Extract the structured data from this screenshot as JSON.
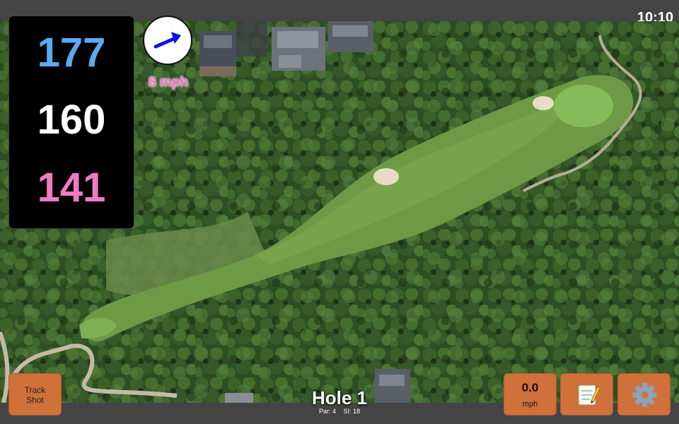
{
  "status_bar": {
    "time": "10:10"
  },
  "yardages": {
    "back": "177",
    "middle": "160",
    "front": "141"
  },
  "wind": {
    "speed_text": "8 mph",
    "direction_icon": "arrow-right-up-icon",
    "arrow_color": "#1010e0"
  },
  "hole": {
    "title": "Hole 1",
    "par": "Par: 4",
    "stroke_index": "SI: 18"
  },
  "buttons": {
    "track_shot_line1": "Track",
    "track_shot_line2": "Shot",
    "speed_value": "0.0",
    "speed_unit": "mph",
    "notes_icon": "notepad-icon",
    "settings_icon": "gear-icon"
  },
  "colors": {
    "button": "#d0703a",
    "back_yard": "#5aaaf0",
    "front_yard": "#f27ac2",
    "wind_text": "#ff6ad2"
  }
}
